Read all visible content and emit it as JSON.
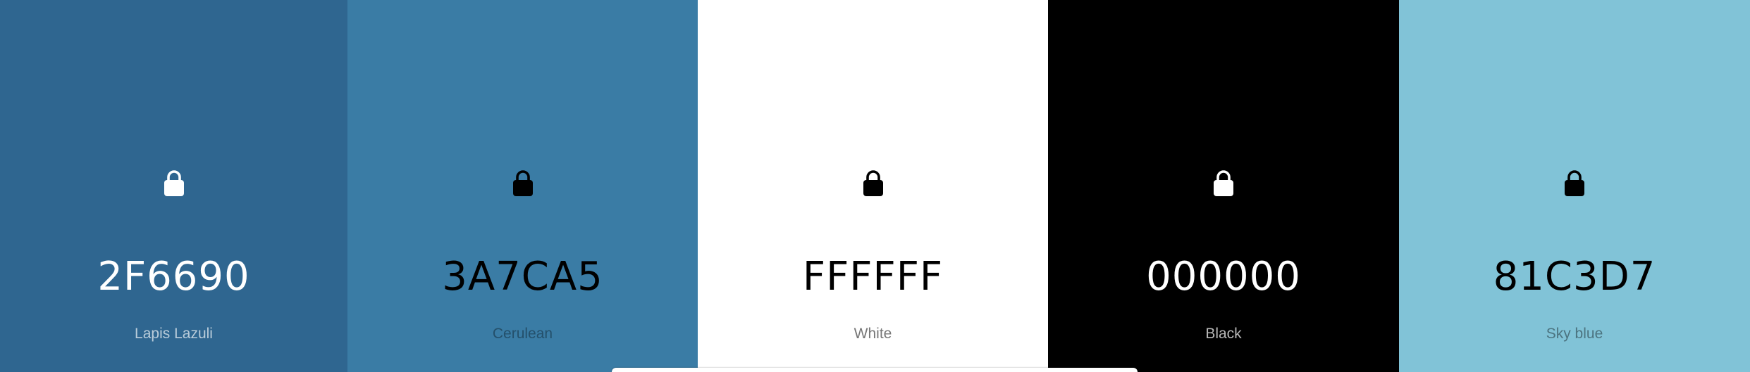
{
  "swatches": [
    {
      "hex": "2F6690",
      "name": "Lapis Lazuli",
      "bg": "#2F6690",
      "text_color": "#FFFFFF",
      "name_color": "#B9CCDA",
      "lock_color": "#FFFFFF",
      "lock_icon": "lock-icon"
    },
    {
      "hex": "3A7CA5",
      "name": "Cerulean",
      "bg": "#3A7CA5",
      "text_color": "#000000",
      "name_color": "#24506B",
      "lock_color": "#000000",
      "lock_icon": "lock-icon"
    },
    {
      "hex": "FFFFFF",
      "name": "White",
      "bg": "#FFFFFF",
      "text_color": "#000000",
      "name_color": "#777777",
      "lock_color": "#000000",
      "lock_icon": "lock-icon"
    },
    {
      "hex": "000000",
      "name": "Black",
      "bg": "#000000",
      "text_color": "#FFFFFF",
      "name_color": "#B8B8B8",
      "lock_color": "#FFFFFF",
      "lock_icon": "lock-icon"
    },
    {
      "hex": "81C3D7",
      "name": "Sky blue",
      "bg": "#81C3D7",
      "text_color": "#000000",
      "name_color": "#4C7480",
      "lock_color": "#000000",
      "lock_icon": "lock-icon"
    }
  ]
}
